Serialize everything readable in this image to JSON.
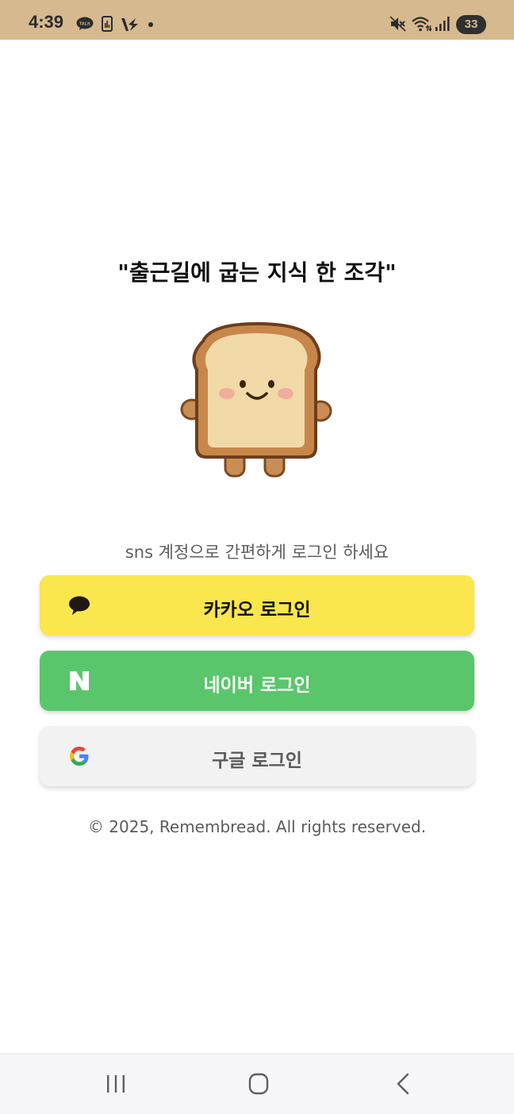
{
  "status_bar": {
    "time": "4:39",
    "battery": "33",
    "icons": [
      "kakaotalk-icon",
      "phone-stats-icon",
      "v-app-icon",
      "dot-icon",
      "mute-icon",
      "wifi-icon",
      "signal-icon"
    ],
    "color": "#d6b98f"
  },
  "main": {
    "tagline": "\"출근길에 굽는 지식 한 조각\"",
    "mascot_icon": "toast-mascot-icon",
    "subtitle": "sns 계정으로 간편하게 로그인 하세요"
  },
  "buttons": {
    "kakao": {
      "label": "카카오 로그인",
      "icon": "kakao-speech-bubble-icon",
      "color": "#fae64d"
    },
    "naver": {
      "label": "네이버 로그인",
      "icon": "naver-n-icon",
      "color": "#5ac66b"
    },
    "google": {
      "label": "구글 로그인",
      "icon": "google-g-icon",
      "color": "#f2f2f2"
    }
  },
  "footer": {
    "copyright": "© 2025, Remembread. All rights reserved."
  },
  "nav_bar": {
    "icons": [
      "recent-apps-icon",
      "home-icon",
      "back-icon"
    ]
  }
}
